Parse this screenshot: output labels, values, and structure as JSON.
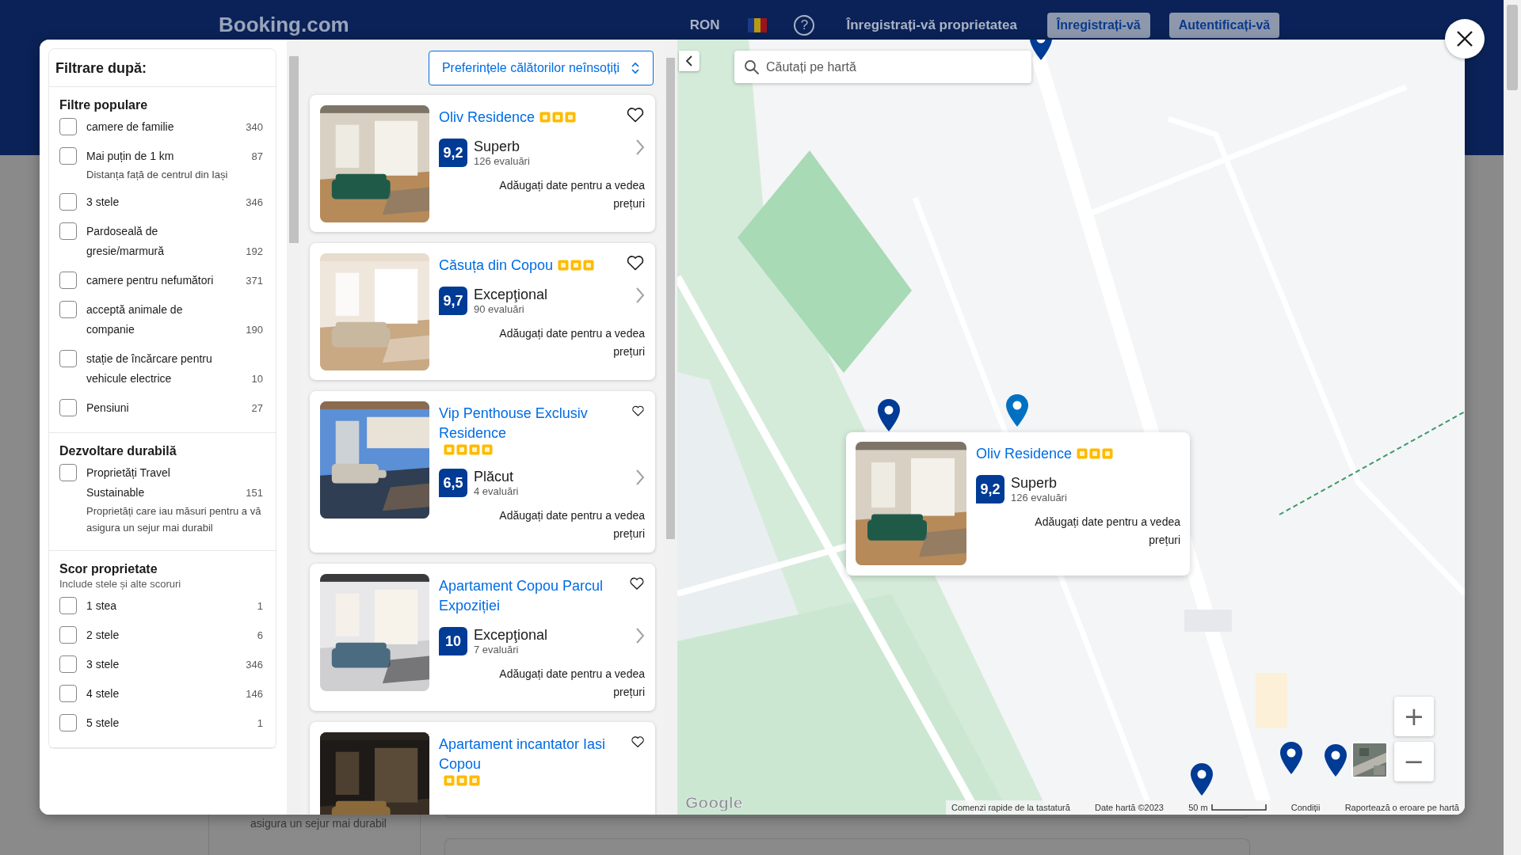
{
  "header": {
    "logo": "Booking.com",
    "currency": "RON",
    "help": "?",
    "list_property": "Înregistrați-vă proprietatea",
    "register_button": "Înregistrați-vă",
    "signin_button": "Autentificați-vă"
  },
  "background_note": "asigura un sejur mai durabil",
  "filters": {
    "title": "Filtrare după:",
    "groups": [
      {
        "title": "Filtre populare",
        "items": [
          {
            "label": "camere de familie",
            "count": "340",
            "checked": false
          },
          {
            "label": "Mai puțin de 1 km",
            "count": "87",
            "checked": false,
            "note": "Distanța față de centrul din Iași"
          },
          {
            "label": "3 stele",
            "count": "346",
            "checked": false
          },
          {
            "label": "Pardoseală de gresie/marmură",
            "count": "192",
            "checked": false
          },
          {
            "label": "camere pentru nefumători",
            "count": "371",
            "checked": false
          },
          {
            "label": "acceptă animale de companie",
            "count": "190",
            "checked": false
          },
          {
            "label": "stație de încărcare pentru vehicule electrice",
            "count": "10",
            "checked": false
          },
          {
            "label": "Pensiuni",
            "count": "27",
            "checked": false
          }
        ]
      },
      {
        "title": "Dezvoltare durabilă",
        "items": [
          {
            "label": "Proprietăți Travel Sustainable",
            "count": "151",
            "checked": false,
            "note": "Proprietăți care iau măsuri pentru a vă asigura un sejur mai durabil"
          }
        ]
      },
      {
        "title": "Scor proprietate",
        "subtitle": "Include stele și alte scoruri",
        "items": [
          {
            "label": "1 stea",
            "count": "1",
            "checked": false
          },
          {
            "label": "2 stele",
            "count": "6",
            "checked": false
          },
          {
            "label": "3 stele",
            "count": "346",
            "checked": false
          },
          {
            "label": "4 stele",
            "count": "146",
            "checked": false
          },
          {
            "label": "5 stele",
            "count": "1",
            "checked": false
          }
        ]
      }
    ]
  },
  "sort_button": "Preferințele călătorilor neînsoțiți",
  "listings": [
    {
      "name": "Oliv Residence",
      "stars": 3,
      "score": "9,2",
      "rating": "Superb",
      "reviews": "126 evaluări",
      "price_note": "Adăugați date pentru a vedea prețuri",
      "favorite": false
    },
    {
      "name": "Căsuța din Copou",
      "stars": 3,
      "score": "9,7",
      "rating": "Excepţional",
      "reviews": "90 evaluări",
      "price_note": "Adăugați date pentru a vedea prețuri",
      "favorite": false
    },
    {
      "name": "Vip Penthouse Exclusiv Residence",
      "stars": 4,
      "score": "6,5",
      "rating": "Plăcut",
      "reviews": "4 evaluări",
      "price_note": "Adăugați date pentru a vedea prețuri",
      "favorite": false
    },
    {
      "name": "Apartament Copou Parcul Expoziției",
      "score": "10",
      "rating": "Excepţional",
      "reviews": "7 evaluări",
      "price_note": "Adăugați date pentru a vedea prețuri",
      "favorite": false
    },
    {
      "name": "Apartament incantator Iasi Copou",
      "stars": 3,
      "favorite": false
    }
  ],
  "map": {
    "search": {
      "placeholder": "Căutați pe hartă"
    },
    "pins": [
      {
        "selected": false
      },
      {
        "selected": false
      },
      {
        "selected": true
      },
      {
        "selected": false
      },
      {
        "selected": false
      },
      {
        "selected": false
      }
    ],
    "popup": {
      "name": "Oliv Residence",
      "stars": 3,
      "score": "9,2",
      "rating": "Superb",
      "reviews": "126 evaluări",
      "price_note": "Adăugați date pentru a vedea prețuri"
    },
    "zoom_in": "+",
    "zoom_out": "−",
    "logo": "Google",
    "attribution": [
      "Comenzi rapide de la tastatură",
      "Date hartă ©2023",
      "50 m",
      "Condiții",
      "Raportează o eroare pe hartă"
    ]
  }
}
